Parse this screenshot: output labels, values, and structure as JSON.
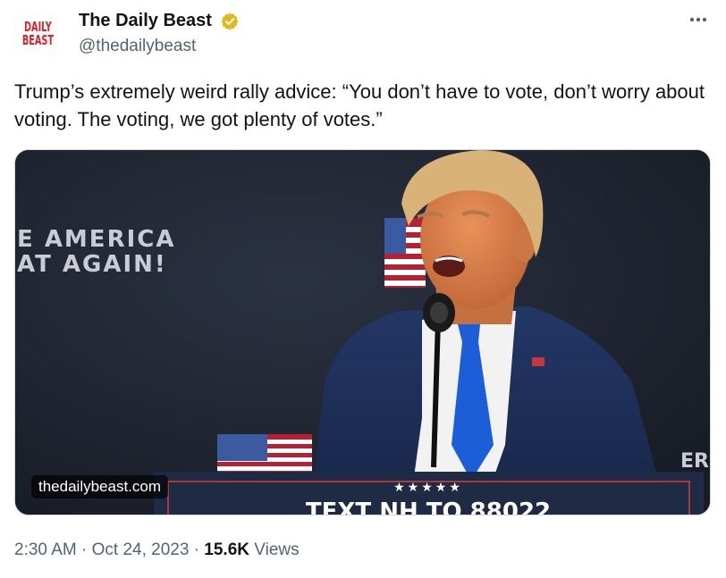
{
  "account": {
    "logo_line1": "DAILY",
    "logo_line2": "BEAST",
    "display_name": "The Daily Beast",
    "handle": "@thedailybeast",
    "verified_color": "#e2b719"
  },
  "tweet": {
    "text": "Trump’s extremely weird rally advice: “You don’t have to vote, don’t worry about voting. The voting, we got plenty of votes.”"
  },
  "media": {
    "watermark": "thedailybeast.com",
    "banner_line1": "E AMERICA",
    "banner_line2": "AT AGAIN!",
    "podium_stars": "★★★★★",
    "podium_text": "TEXT NH TO 88022",
    "right_edge_text": "ER"
  },
  "meta": {
    "time": "2:30 AM",
    "separator1": " · ",
    "date": "Oct 24, 2023",
    "separator2": " · ",
    "views_count": "15.6K",
    "views_label": " Views"
  },
  "icons": {
    "verified": "verified-badge-icon",
    "more": "more-options-icon"
  }
}
